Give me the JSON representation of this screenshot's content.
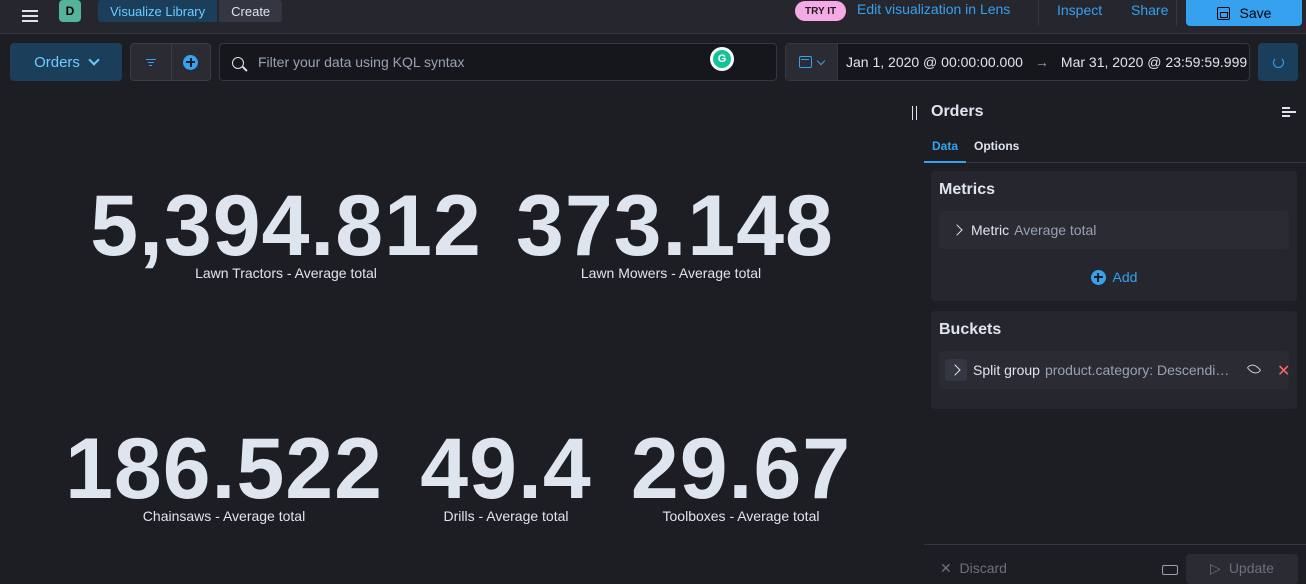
{
  "header": {
    "space_initial": "D",
    "breadcrumbs": [
      "Visualize Library",
      "Create"
    ],
    "lens_badge": "TRY IT",
    "lens_link": "Edit visualization in Lens",
    "inspect": "Inspect",
    "share": "Share",
    "save": "Save"
  },
  "query": {
    "index_pattern": "Orders",
    "placeholder": "Filter your data using KQL syntax",
    "grammarly": "G",
    "date_start": "Jan 1, 2020 @ 00:00:00.000",
    "date_arrow": "→",
    "date_end": "Mar 31, 2020 @ 23:59:59.999"
  },
  "metrics": [
    {
      "value": "5,394.812",
      "label": "Lawn Tractors - Average total"
    },
    {
      "value": "373.148",
      "label": "Lawn Mowers - Average total"
    },
    {
      "value": "186.522",
      "label": "Chainsaws - Average total"
    },
    {
      "value": "49.4",
      "label": "Drills - Average total"
    },
    {
      "value": "29.67",
      "label": "Toolboxes - Average total"
    }
  ],
  "sidebar": {
    "title": "Orders",
    "tabs": [
      "Data",
      "Options"
    ],
    "metrics_title": "Metrics",
    "metric_row": {
      "title": "Metric",
      "desc": "Average total"
    },
    "add_label": "Add",
    "buckets_title": "Buckets",
    "bucket_row": {
      "title": "Split group",
      "desc": "product.category: Descending"
    },
    "remove_glyph": "✕",
    "discard": "Discard",
    "update": "Update",
    "discard_glyph": "✕",
    "update_glyph": "▷"
  }
}
